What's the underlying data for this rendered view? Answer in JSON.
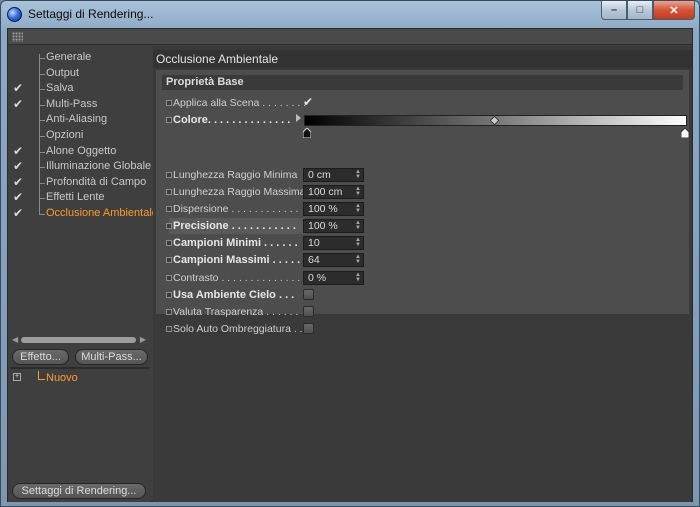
{
  "window": {
    "title": "Settaggi di Rendering...",
    "minimize": "–",
    "maximize": "□",
    "close": "✕"
  },
  "tree": [
    {
      "label": "Generale",
      "checked": false,
      "active": false
    },
    {
      "label": "Output",
      "checked": false,
      "active": false
    },
    {
      "label": "Salva",
      "checked": true,
      "active": false
    },
    {
      "label": "Multi-Pass",
      "checked": true,
      "active": false
    },
    {
      "label": "Anti-Aliasing",
      "checked": false,
      "active": false
    },
    {
      "label": "Opzioni",
      "checked": false,
      "active": false
    },
    {
      "label": "Alone Oggetto",
      "checked": true,
      "active": false
    },
    {
      "label": "Illuminazione Globale",
      "checked": true,
      "active": false
    },
    {
      "label": "Profondità di Campo",
      "checked": true,
      "active": false
    },
    {
      "label": "Effetti Lente",
      "checked": true,
      "active": false
    },
    {
      "label": "Occlusione Ambientale",
      "checked": true,
      "active": true
    }
  ],
  "buttons": {
    "effetto": "Effetto...",
    "multipass": "Multi-Pass...",
    "settings": "Settaggi di Rendering..."
  },
  "lower_list": {
    "item": "Nuovo"
  },
  "panel": {
    "title": "Occlusione Ambientale",
    "section": "Proprietà Base",
    "rows": {
      "applica": {
        "label": "Applica alla Scena . . . . . . . .",
        "checked": true
      },
      "colore": {
        "label": "Colore. . . . . . . . . . . . . ."
      },
      "raggio_min": {
        "label": "Lunghezza Raggio Minima",
        "value": "0 cm"
      },
      "raggio_max": {
        "label": "Lunghezza Raggio Massima",
        "value": "100 cm"
      },
      "dispersione": {
        "label": "Dispersione . . . . . . . . . . . .",
        "value": "100 %"
      },
      "precisione": {
        "label": "Precisione . . . . . . . . . . .",
        "value": "100 %"
      },
      "campioni_min": {
        "label": "Campioni Minimi . . . . . .",
        "value": "10"
      },
      "campioni_max": {
        "label": "Campioni Massimi . . . . .",
        "value": "64"
      },
      "contrasto": {
        "label": "Contrasto . . . . . . . . . . . . . .",
        "value": "0 %"
      },
      "usa_ambiente": {
        "label": "Usa Ambiente Cielo . . .",
        "checked": false
      },
      "valuta": {
        "label": "Valuta Trasparenza . . . . . .",
        "checked": false
      },
      "solo_auto": {
        "label": "Solo Auto Ombreggiatura . .",
        "checked": false
      }
    }
  }
}
